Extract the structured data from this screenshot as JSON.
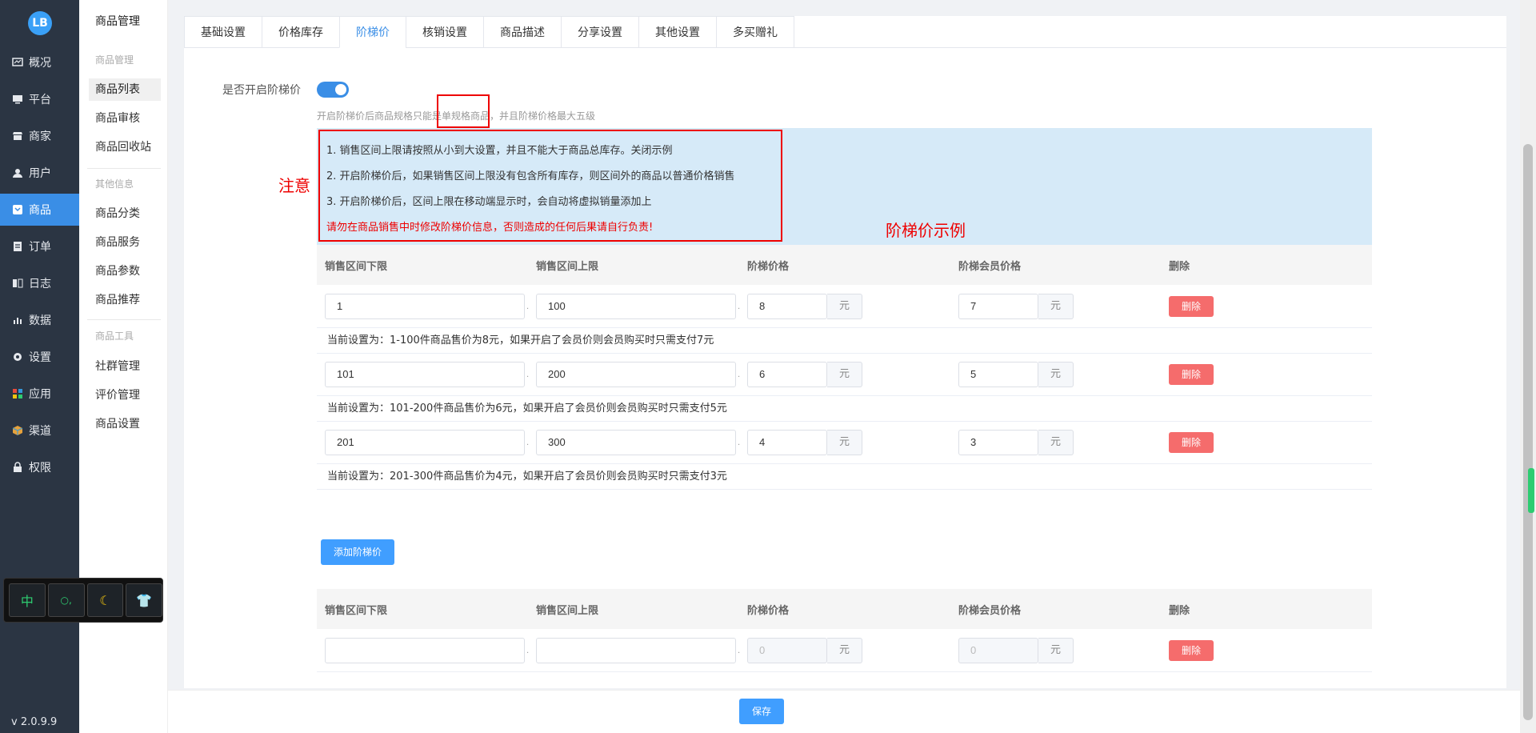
{
  "sidebar": {
    "logo": "LB",
    "items": [
      {
        "label": "概况",
        "icon": "dashboard-icon"
      },
      {
        "label": "平台",
        "icon": "monitor-icon"
      },
      {
        "label": "商家",
        "icon": "store-icon"
      },
      {
        "label": "用户",
        "icon": "user-icon"
      },
      {
        "label": "商品",
        "icon": "goods-icon",
        "active": true
      },
      {
        "label": "订单",
        "icon": "order-icon"
      },
      {
        "label": "日志",
        "icon": "log-icon"
      },
      {
        "label": "数据",
        "icon": "chart-icon"
      },
      {
        "label": "设置",
        "icon": "gear-icon"
      },
      {
        "label": "应用",
        "icon": "apps-icon"
      },
      {
        "label": "渠道",
        "icon": "cube-icon"
      },
      {
        "label": "权限",
        "icon": "lock-icon"
      }
    ],
    "version": "v 2.0.9.9"
  },
  "subnav": {
    "title": "商品管理",
    "group1": "商品管理",
    "group1_items": [
      "商品列表",
      "商品审核",
      "商品回收站"
    ],
    "group2": "其他信息",
    "group2_items": [
      "商品分类",
      "商品服务",
      "商品参数",
      "商品推荐"
    ],
    "group3": "商品工具",
    "group3_items": [
      "社群管理",
      "评价管理",
      "商品设置"
    ]
  },
  "ime": {
    "keys": [
      "中",
      "○,",
      "☾",
      "👕"
    ]
  },
  "tabs": [
    "基础设置",
    "价格库存",
    "阶梯价",
    "核销设置",
    "商品描述",
    "分享设置",
    "其他设置",
    "多买赠礼"
  ],
  "active_tab": "阶梯价",
  "switch": {
    "label": "是否开启阶梯价",
    "on": true
  },
  "hint": "开启阶梯价后商品规格只能是单规格商品，并且阶梯价格最大五级",
  "tips": [
    "1. 销售区间上限请按照从小到大设置，并且不能大于商品总库存。关闭示例",
    "2. 开启阶梯价后，如果销售区间上限没有包含所有库存，则区间外的商品以普通价格销售",
    "3. 开启阶梯价后，区间上限在移动端显示时，会自动将虚拟销量添加上",
    "请勿在商品销售中时修改阶梯价信息，否则造成的任何后果请自行负责!"
  ],
  "annotations": {
    "note": "注意",
    "example": "阶梯价示例"
  },
  "table_headers": [
    "销售区间下限",
    "销售区间上限",
    "阶梯价格",
    "阶梯会员价格",
    "删除"
  ],
  "unit": "元",
  "delete_label": "删除",
  "example_rows": [
    {
      "min": "1",
      "max": "100",
      "price": "8",
      "member_price": "7",
      "desc": "当前设置为：1-100件商品售价为8元，如果开启了会员价则会员购买时只需支付7元"
    },
    {
      "min": "101",
      "max": "200",
      "price": "6",
      "member_price": "5",
      "desc": "当前设置为：101-200件商品售价为6元，如果开启了会员价则会员购买时只需支付5元"
    },
    {
      "min": "201",
      "max": "300",
      "price": "4",
      "member_price": "3",
      "desc": "当前设置为：201-300件商品售价为4元，如果开启了会员价则会员购买时只需支付3元"
    }
  ],
  "add_button": "添加阶梯价",
  "edit_row": {
    "min": "",
    "max": "",
    "price_placeholder": "0",
    "member_price_placeholder": "0"
  },
  "save_button": "保存"
}
